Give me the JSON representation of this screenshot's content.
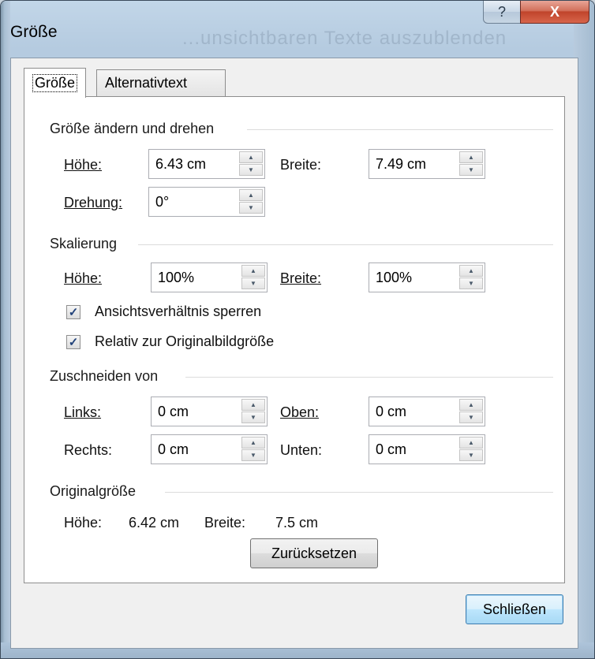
{
  "window": {
    "title": "Größe",
    "background_title": "...unsichtbaren Texte auszublenden",
    "help_glyph": "?",
    "close_glyph": "X"
  },
  "tabs": [
    {
      "label": "Größe",
      "active": true
    },
    {
      "label": "Alternativtext",
      "active": false
    }
  ],
  "size_rotate": {
    "header": "Größe ändern und drehen",
    "height_label": "Höhe:",
    "height_value": "6.43 cm",
    "width_label": "Breite:",
    "width_value": "7.49 cm",
    "rotation_label": "Drehung:",
    "rotation_value": "0°"
  },
  "scale": {
    "header": "Skalierung",
    "height_label": "Höhe:",
    "height_value": "100%",
    "width_label": "Breite:",
    "width_value": "100%",
    "lock_aspect_label": "Ansichtsverhältnis sperren",
    "lock_aspect_checked": true,
    "relative_label": "Relativ zur Originalbildgröße",
    "relative_checked": true
  },
  "crop": {
    "header": "Zuschneiden von",
    "left_label": "Links:",
    "left_value": "0 cm",
    "top_label": "Oben:",
    "top_value": "0 cm",
    "right_label": "Rechts:",
    "right_value": "0 cm",
    "bottom_label": "Unten:",
    "bottom_value": "0 cm"
  },
  "original": {
    "header": "Originalgröße",
    "height_label": "Höhe:",
    "height_value": "6.42 cm",
    "width_label": "Breite:",
    "width_value": "7.5 cm",
    "reset_label": "Zurücksetzen"
  },
  "footer": {
    "close_label": "Schließen"
  },
  "colors": {
    "close_button": "#c0442b",
    "checkmark": "#21427a",
    "default_button_border": "#3c7fb1"
  }
}
